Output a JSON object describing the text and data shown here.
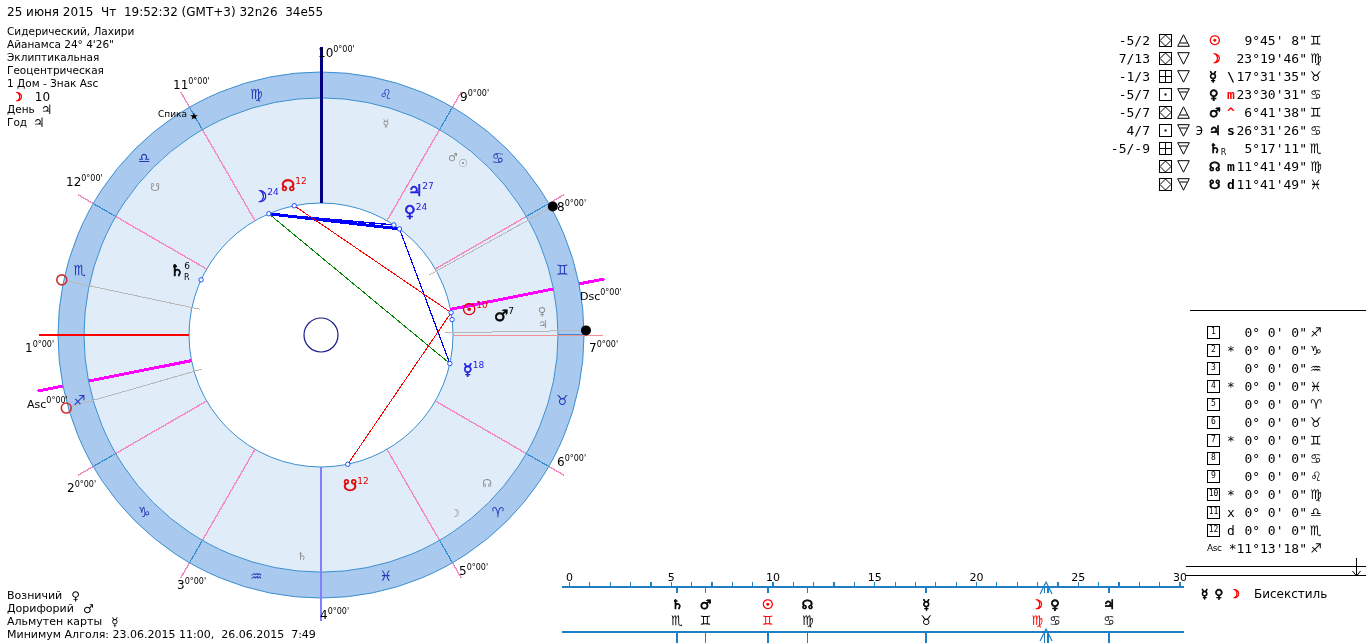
{
  "header": {
    "datetime": "25 июня 2015  Чт  19:52:32 (GMT+3) 32n26  34e55"
  },
  "settings": [
    "Сидерический, Лахири",
    "Айанамса 24° 4'26\"",
    "Эклиптикальная",
    "Геоцентрическая",
    "1 Дом - Знак Asc"
  ],
  "moon_day": {
    "symbol": "☽",
    "color": "#ff0000",
    "value": "10"
  },
  "rulers_top": [
    {
      "label": "День",
      "symbol": "♃"
    },
    {
      "label": "Год",
      "symbol": "♃"
    }
  ],
  "wheel": {
    "houses": [
      {
        "number": "1",
        "degree": "0°00'",
        "color": "#ff0000"
      },
      {
        "number": "2",
        "degree": "0°00'",
        "color": "#f48ac4"
      },
      {
        "number": "3",
        "degree": "0°00'",
        "color": "#f48ac4"
      },
      {
        "number": "4",
        "degree": "0°00'",
        "color": "#8080ff"
      },
      {
        "number": "5",
        "degree": "0°00'",
        "color": "#f48ac4"
      },
      {
        "number": "6",
        "degree": "0°00'",
        "color": "#f48ac4"
      },
      {
        "number": "7",
        "degree": "0°00'",
        "color": "#f09090"
      },
      {
        "number": "8",
        "degree": "0°00'",
        "color": "#f48ac4"
      },
      {
        "number": "9",
        "degree": "0°00'",
        "color": "#f48ac4"
      },
      {
        "number": "10",
        "degree": "0°00'",
        "color": "#000080"
      },
      {
        "number": "11",
        "degree": "0°00'",
        "color": "#f48ac4"
      },
      {
        "number": "12",
        "degree": "0°00'",
        "color": "#f48ac4"
      }
    ],
    "angles": [
      {
        "label": "Asc",
        "degree": "0°00'"
      },
      {
        "label": "Dsc",
        "degree": "0°00'"
      }
    ],
    "zodiac": [
      "♈",
      "♉",
      "♊",
      "♋",
      "♌",
      "♍",
      "♎",
      "♏",
      "♐",
      "♑",
      "♒",
      "♓"
    ],
    "star": {
      "name": "Спика"
    },
    "planets": [
      {
        "symbol": "☽",
        "degree": "24",
        "color": "#2020e0"
      },
      {
        "symbol": "☊",
        "degree": "12",
        "color": "#e00000"
      },
      {
        "symbol": "♃",
        "degree": "27",
        "color": "#2020e0"
      },
      {
        "symbol": "♀",
        "degree": "24",
        "color": "#2020e0"
      },
      {
        "symbol": "♄",
        "degree": "6",
        "suffix": "R",
        "color": "#000000"
      },
      {
        "symbol": "☉",
        "degree": "10",
        "color": "#e00000"
      },
      {
        "symbol": "♂",
        "degree": "7",
        "color": "#000000"
      },
      {
        "symbol": "☿",
        "degree": "18",
        "color": "#2020e0"
      },
      {
        "symbol": "☋",
        "degree": "12",
        "color": "#e00000"
      }
    ],
    "secondary_symbols": [
      "☿",
      "♂",
      "☉",
      "♀",
      "♃",
      "☊",
      "☽",
      "♄",
      "☋"
    ],
    "markers": [
      {
        "kind": "ring",
        "color": "#cc3333"
      },
      {
        "kind": "ring",
        "color": "#cc3333"
      },
      {
        "kind": "dot",
        "color": "#000000"
      },
      {
        "kind": "dot",
        "color": "#000000"
      }
    ],
    "aspects": [
      {
        "color": "#0000ff"
      },
      {
        "color": "#0000ff"
      },
      {
        "color": "#0000ff"
      },
      {
        "color": "#008000"
      },
      {
        "color": "#ff0000"
      },
      {
        "color": "#ff0000"
      }
    ]
  },
  "positions_table": [
    {
      "score": "-5/2",
      "kind": "diamond-air",
      "planet": "☉",
      "color": "#ff0000",
      "position": "9°45' 8\"",
      "sign": "♊"
    },
    {
      "score": "7/13",
      "kind": "diamond-water",
      "planet": "☽",
      "color": "#ff0000",
      "position": "23°19'46\"",
      "sign": "♍"
    },
    {
      "score": "-1/3",
      "kind": "plus-water",
      "planet": "☿",
      "color": "#000000",
      "prefix": {
        "text": "\\",
        "color": "#000000"
      },
      "position": "17°31'35\"",
      "sign": "♉"
    },
    {
      "score": "-5/7",
      "kind": "dot-earth",
      "planet": "♀",
      "color": "#000000",
      "prefix": {
        "text": "m",
        "color": "#ff0000"
      },
      "position": "23°30'31\"",
      "sign": "♋"
    },
    {
      "score": "-5/7",
      "kind": "diamond-air",
      "planet": "♂",
      "color": "#000000",
      "prefix": {
        "text": "^",
        "color": "#ff0000"
      },
      "position": "6°41'38\"",
      "sign": "♊"
    },
    {
      "score": "4/7",
      "kind": "dot-earth",
      "mark": "Э",
      "planet": "♃",
      "color": "#000000",
      "prefix": {
        "text": "s",
        "color": "#000000"
      },
      "position": "26°31'26\"",
      "sign": "♋"
    },
    {
      "score": "-5/-9",
      "kind": "plus-earth",
      "planet": "♄",
      "suffix": "R",
      "color": "#000000",
      "position": "5°17'11\"",
      "sign": "♏"
    },
    {
      "kind": "diamond-water",
      "planet": "☊",
      "color": "#000000",
      "prefix": {
        "text": "m",
        "color": "#000000"
      },
      "position": "11°41'49\"",
      "sign": "♍"
    },
    {
      "kind": "diamond-earth",
      "planet": "☋",
      "color": "#000000",
      "prefix": {
        "text": "d",
        "color": "#000000"
      },
      "position": "11°41'49\"",
      "sign": "♓"
    }
  ],
  "houses_table": {
    "rows": [
      {
        "number": "1",
        "position": "0° 0' 0\"",
        "sign": "♐"
      },
      {
        "number": "2",
        "mark": "*",
        "position": "0° 0' 0\"",
        "sign": "♑"
      },
      {
        "number": "3",
        "position": "0° 0' 0\"",
        "sign": "♒"
      },
      {
        "number": "4",
        "mark": "*",
        "position": "0° 0' 0\"",
        "sign": "♓"
      },
      {
        "number": "5",
        "position": "0° 0' 0\"",
        "sign": "♈"
      },
      {
        "number": "6",
        "position": "0° 0' 0\"",
        "sign": "♉"
      },
      {
        "number": "7",
        "mark": "*",
        "position": "0° 0' 0\"",
        "sign": "♊"
      },
      {
        "number": "8",
        "position": "0° 0' 0\"",
        "sign": "♋"
      },
      {
        "number": "9",
        "position": "0° 0' 0\"",
        "sign": "♌"
      },
      {
        "number": "10",
        "mark": "*",
        "position": "0° 0' 0\"",
        "sign": "♍"
      },
      {
        "number": "11",
        "mark": "x",
        "position": "0° 0' 0\"",
        "sign": "♎"
      },
      {
        "number": "12",
        "mark": "d",
        "position": "0° 0' 0\"",
        "sign": "♏"
      }
    ],
    "ascendant": {
      "label": "Asc",
      "position": "*11°13'18\"",
      "sign": "♐"
    }
  },
  "aspect_note": {
    "symbols": [
      {
        "glyph": "☿",
        "color": "#000000"
      },
      {
        "glyph": "♀",
        "color": "#000000"
      },
      {
        "glyph": "☽",
        "color": "#ff0000"
      }
    ],
    "label": "Бисекстиль"
  },
  "degree_ruler": {
    "tick_labels": [
      "0",
      "5",
      "10",
      "15",
      "20",
      "25",
      "30"
    ],
    "markers": [
      {
        "planet": "♄",
        "sign": "♏",
        "color": "#000000"
      },
      {
        "planet": "♂",
        "sign": "♊",
        "color": "#000000"
      },
      {
        "planet": "☉",
        "sign": "♊",
        "color": "#ff0000"
      },
      {
        "planet": "☊",
        "sign": "♍",
        "color": "#000000"
      },
      {
        "planet": "☿",
        "sign": "♉",
        "color": "#000000"
      },
      {
        "planet": "☽",
        "sign": "♍",
        "color": "#ff0000"
      },
      {
        "planet": "♀",
        "sign": "♋",
        "color": "#000000"
      },
      {
        "planet": "♃",
        "sign": "♋",
        "color": "#000000"
      }
    ]
  },
  "footer": {
    "rulers": [
      {
        "label": "Возничий",
        "symbol": "♀"
      },
      {
        "label": "Дорифорий",
        "symbol": "♂"
      },
      {
        "label": "Альмутен карты",
        "symbol": "☿"
      }
    ],
    "algol": "Минимум Алголя: 23.06.2015 11:00,  26.06.2015  7:49"
  }
}
